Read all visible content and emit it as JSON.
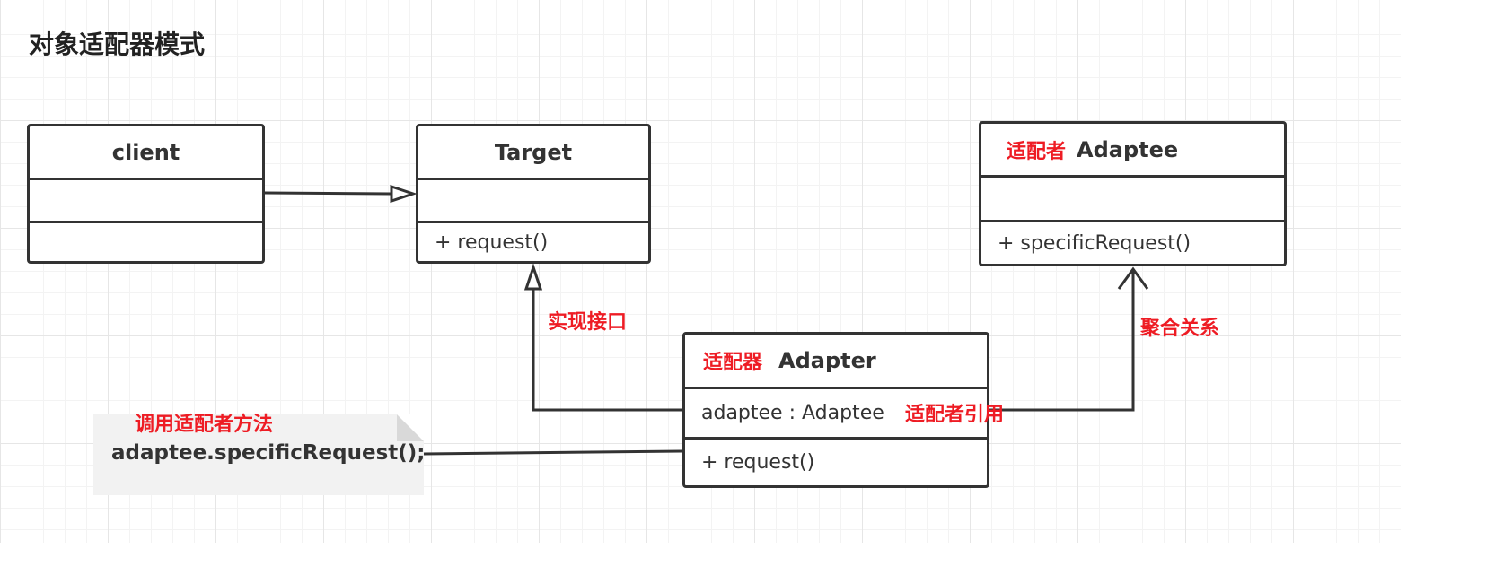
{
  "title": "对象适配器模式",
  "classes": {
    "client": {
      "name": "client",
      "attributes": "",
      "methods": ""
    },
    "target": {
      "name": "Target",
      "attributes": "",
      "methods": "+ request()"
    },
    "adaptee": {
      "tag": "适配者",
      "name": "Adaptee",
      "attributes": "",
      "methods": "+ specificRequest()"
    },
    "adapter": {
      "tag": "适配器",
      "name": "Adapter",
      "attributes": "adaptee : Adaptee",
      "attribute_note": "适配者引用",
      "methods": "+ request()"
    }
  },
  "relations": {
    "implements_label": "实现接口",
    "aggregation_label": "聚合关系"
  },
  "note": {
    "label": "调用适配者方法",
    "code": "adaptee.specificRequest();"
  },
  "colors": {
    "line": "#333333",
    "annotation": "#ee1c24",
    "note_bg": "#f2f2f2"
  }
}
